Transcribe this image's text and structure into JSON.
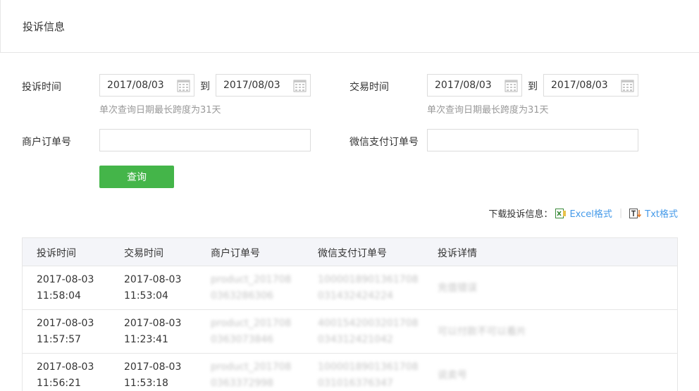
{
  "header": {
    "title": "投诉信息"
  },
  "filters": {
    "complaint_time_label": "投诉时间",
    "trade_time_label": "交易时间",
    "to_label": "到",
    "complaint_start": "2017/08/03",
    "complaint_end": "2017/08/03",
    "trade_start": "2017/08/03",
    "trade_end": "2017/08/03",
    "range_hint": "单次查询日期最长跨度为31天",
    "merchant_order_label": "商户订单号",
    "merchant_order_value": "",
    "wechat_order_label": "微信支付订单号",
    "wechat_order_value": "",
    "query_button": "查询"
  },
  "download": {
    "label": "下载投诉信息：",
    "excel": "Excel格式",
    "txt": "Txt格式"
  },
  "table": {
    "headers": [
      "投诉时间",
      "交易时间",
      "商户订单号",
      "微信支付订单号",
      "投诉详情"
    ],
    "rows": [
      {
        "complaint_date": "2017-08-03",
        "complaint_time": "11:58:04",
        "trade_date": "2017-08-03",
        "trade_time": "11:53:04",
        "merchant_a": "product_201708",
        "merchant_b": "0363286306",
        "wechat_a": "10000189013617​08",
        "wechat_b": "031432424224",
        "detail": "充值错误"
      },
      {
        "complaint_date": "2017-08-03",
        "complaint_time": "11:57:57",
        "trade_date": "2017-08-03",
        "trade_time": "11:23:41",
        "merchant_a": "product_201708",
        "merchant_b": "0363073846",
        "wechat_a": "40015420032017​08",
        "wechat_b": "03431242​1042",
        "detail": "可以付款不可以看片"
      },
      {
        "complaint_date": "2017-08-03",
        "complaint_time": "11:56:21",
        "trade_date": "2017-08-03",
        "trade_time": "11:53:18",
        "merchant_a": "product_201708",
        "merchant_b": "0363372998",
        "wechat_a": "10000189013617​08",
        "wechat_b": "03101637​6347",
        "detail": "说卖号"
      }
    ]
  }
}
